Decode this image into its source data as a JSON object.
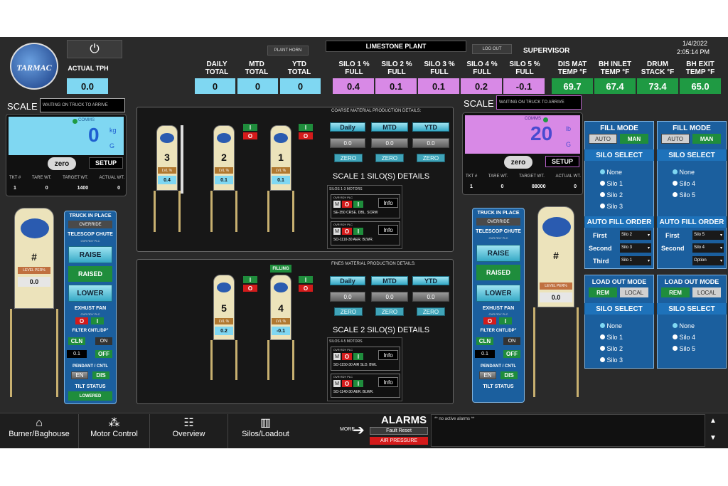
{
  "header": {
    "actual_tph_label": "ACTUAL TPH",
    "actual_tph_value": "0.0",
    "plant_horn": "PLANT HORN",
    "plant_name": "LIMESTONE PLANT",
    "log_out": "LOG OUT",
    "user": "SUPERVISOR",
    "date": "1/4/2022",
    "time": "2:05:14 PM",
    "totals": [
      {
        "label": "DAILY TOTAL",
        "value": "0"
      },
      {
        "label": "MTD TOTAL",
        "value": "0"
      },
      {
        "label": "YTD TOTAL",
        "value": "0"
      }
    ],
    "silos": [
      {
        "label": "SILO 1 % FULL",
        "value": "0.4"
      },
      {
        "label": "SILO 2 % FULL",
        "value": "0.1"
      },
      {
        "label": "SILO 3 % FULL",
        "value": "0.1"
      },
      {
        "label": "SILO 4 % FULL",
        "value": "0.2"
      },
      {
        "label": "SILO 5 % FULL",
        "value": "-0.1"
      }
    ],
    "temps": [
      {
        "label": "DIS MAT TEMP °F",
        "value": "69.7"
      },
      {
        "label": "BH INLET TEMP °F",
        "value": "67.4"
      },
      {
        "label": "DRUM STACK °F",
        "value": "73.4"
      },
      {
        "label": "BH EXIT TEMP °F",
        "value": "65.0"
      }
    ]
  },
  "scale1": {
    "title": "SCALE 1",
    "status": "WAITING ON TRUCK TO ARRIVE",
    "comms": "COMMS",
    "weight": "0",
    "unit_top": "kg",
    "unit_bottom": "G",
    "zero": "zero",
    "setup": "SETUP",
    "cols": [
      "TKT #",
      "TARE WT.",
      "TARGET WT.",
      "ACTUAL WT."
    ],
    "vals": [
      "1",
      "0",
      "1400",
      "0"
    ]
  },
  "scale2": {
    "title": "SCALE 2",
    "status": "WAITING ON TRUCK TO ARRIVE",
    "comms": "COMMS",
    "weight": "20",
    "unit_top": "lb",
    "unit_bottom": "G",
    "zero": "zero",
    "setup": "SETUP",
    "cols": [
      "TKT #",
      "TARE WT.",
      "TARGET WT.",
      "ACTUAL WT."
    ],
    "vals": [
      "1",
      "0",
      "88000",
      "0"
    ]
  },
  "upper_silos": [
    {
      "number": "3",
      "lvl": "LVL %",
      "value": "0.4"
    },
    {
      "number": "2",
      "lvl": "LVL %",
      "value": "0.1"
    },
    {
      "number": "1",
      "lvl": "LVL %",
      "value": "0.1"
    }
  ],
  "lower_silos": [
    {
      "number": "5",
      "lvl": "LVL %",
      "value": "0.2"
    },
    {
      "number": "4",
      "lvl": "LVL %",
      "value": "-0.1",
      "badge": "FILLING"
    }
  ],
  "coarse": {
    "title": "COARSE MATERIAL PRODUCTION DETAILS:",
    "tabs": [
      "Daily",
      "MTD",
      "YTD"
    ],
    "values": [
      "0.0",
      "0.0",
      "0.0"
    ],
    "zero": "ZERO",
    "details_title": "SCALE 1 SILO(S) DETAILS",
    "motors_label": "SILOS 1-3 MOTORS",
    "motors": [
      {
        "status": "OVR RDY PLC",
        "name": "SE-350 CRSE. DBL. SCRW"
      },
      {
        "status": "OVR RDY PLC",
        "name": "SO-1110-30 AER. BLWR."
      }
    ]
  },
  "fines": {
    "title": "FINES MATERIAL PRODUCTION DETAILS:",
    "tabs": [
      "Daily",
      "MTD",
      "YTD"
    ],
    "values": [
      "0.0",
      "0.0",
      "0.0"
    ],
    "zero": "ZERO",
    "details_title": "SCALE 2 SILO(S) DETAILS",
    "motors_label": "SILOS 4-5 MOTORS",
    "motors": [
      {
        "status": "OVR RDY PLC",
        "name": "SO-1150-30 AIR SLD. BWL"
      },
      {
        "status": "OVR RDY PLC",
        "name": "SO-1140-30 AER. BLWR."
      }
    ]
  },
  "motor_btns": {
    "m": "M",
    "o": "O",
    "i": "I",
    "info": "Info"
  },
  "left_station": {
    "silo_mark": "#",
    "level_label": "LEVEL PER%",
    "level_value": "0.0",
    "truck_in_place": "TRUCK IN PLACE",
    "override": "OVERRIDE",
    "telescop": "TELESCOP CHUTE",
    "status": "OVR RDY PLC",
    "raise": "RAISE",
    "raised": "RAISED",
    "lower": "LOWER",
    "exhaust_fan": "EXHUST FAN",
    "filter": "FILTER CNTL/DP\"",
    "cln": "CLN",
    "on": "ON",
    "off": "OFF",
    "dp_value": "0.1",
    "pendant": "PENDANT / CNTL",
    "en": "EN",
    "dis": "DIS",
    "tilt": "TILT STATUS",
    "tilt_value": "LOWERED"
  },
  "right_station": {
    "silo_mark": "#",
    "level_label": "LEVEL PER%",
    "level_value": "0.0",
    "truck_in_place": "TRUCK IN PLACE",
    "override": "OVERRIDE",
    "telescop": "TELESCOP CHUTE",
    "status": "OVR RDY PLC",
    "raise": "RAISE",
    "raised": "RAISED",
    "lower": "LOWER",
    "exhaust_fan": "EXHUST FAN",
    "filter": "FILTER CNTL/DP\"",
    "cln": "CLN",
    "on": "ON",
    "off": "OFF",
    "dp_value": "0.1",
    "pendant": "PENDANT / CNTL",
    "en": "EN",
    "dis": "DIS",
    "tilt": "TILT STATUS"
  },
  "fill1": {
    "fill_mode": "FILL MODE",
    "auto": "AUTO",
    "man": "MAN",
    "silo_select": "SILO SELECT",
    "options": [
      "None",
      "Silo 1",
      "Silo 2",
      "Silo 3"
    ],
    "auto_fill": "AUTO FILL ORDER",
    "order": [
      {
        "label": "First",
        "value": "Silo 2"
      },
      {
        "label": "Second",
        "value": "Silo 3"
      },
      {
        "label": "Third",
        "value": "Silo 1"
      }
    ],
    "load_out": "LOAD OUT MODE",
    "rem": "REM",
    "local": "LOCAL",
    "silo_select2": "SILO SELECT",
    "options2": [
      "None",
      "Silo 1",
      "Silo 2",
      "Silo 3"
    ]
  },
  "fill2": {
    "fill_mode": "FILL MODE",
    "auto": "AUTO",
    "man": "MAN",
    "silo_select": "SILO SELECT",
    "options": [
      "None",
      "Silo 4",
      "Silo 5"
    ],
    "auto_fill": "AUTO FILL ORDER",
    "order": [
      {
        "label": "First",
        "value": "Silo 5"
      },
      {
        "label": "Second",
        "value": "Silo 4"
      },
      {
        "label": "",
        "value": "Option"
      }
    ],
    "load_out": "LOAD OUT MODE",
    "rem": "REM",
    "local": "LOCAL",
    "silo_select2": "SILO SELECT",
    "options2": [
      "None",
      "Silo 4",
      "Silo 5"
    ]
  },
  "nav": [
    "Burner/Baghouse",
    "Motor Control",
    "Overview",
    "Silos/Loadout"
  ],
  "alarms": {
    "more": "MORE",
    "title": "ALARMS",
    "fault_reset": "Fault Reset",
    "air_pressure": "AIR PRESSURE",
    "message": "** no active alarms **"
  },
  "colors": {
    "cyan": "#7fd7f2",
    "magenta": "#d889e6",
    "green": "#1f9a43",
    "accent_blue": "#1b5f9e"
  }
}
